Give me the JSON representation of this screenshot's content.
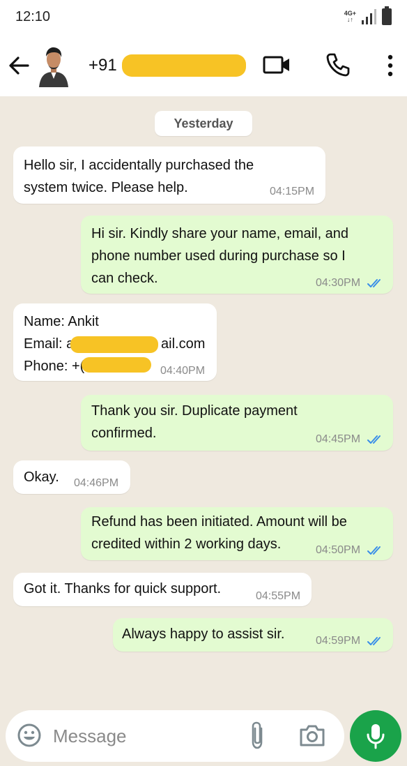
{
  "status_bar": {
    "time": "12:10",
    "network": "4G+",
    "network_arrows": "↓↑"
  },
  "header": {
    "contact_number": "+91",
    "icons": [
      "back-arrow-icon",
      "video-call-icon",
      "voice-call-icon",
      "more-vert-icon"
    ]
  },
  "chat": {
    "date_label": "Yesterday",
    "messages": [
      {
        "direction": "in",
        "text": "Hello sir, I accidentally purchased the\nsystem twice. Please help.",
        "time": "04:15PM"
      },
      {
        "direction": "out",
        "text": "Hi sir. Kindly share your name, email, and\nphone number used during purchase so I\ncan check.",
        "time": "04:30PM",
        "status": "read"
      },
      {
        "direction": "in",
        "name_line": "Name: Ankit",
        "email_prefix": "Email: a",
        "email_suffix": "ail.com",
        "phone_prefix": "Phone: +(",
        "time": "04:40PM"
      },
      {
        "direction": "out",
        "text": "Thank you sir. Duplicate payment\nconfirmed.",
        "time": "04:45PM",
        "status": "read"
      },
      {
        "direction": "in",
        "text": "Okay.",
        "time": "04:46PM"
      },
      {
        "direction": "out",
        "text": "Refund has been initiated. Amount will be\ncredited within 2 working days.",
        "time": "04:50PM",
        "status": "read"
      },
      {
        "direction": "in",
        "text": "Got it. Thanks for quick support.",
        "time": "04:55PM"
      },
      {
        "direction": "out",
        "text": "Always happy to assist sir.",
        "time": "04:59PM",
        "status": "read"
      }
    ]
  },
  "composer": {
    "placeholder": "Message",
    "icons": [
      "emoji-icon",
      "attach-icon",
      "camera-icon",
      "mic-icon"
    ]
  },
  "colors": {
    "accent_green": "#1aa34a",
    "outgoing_bubble": "#e3fbd1",
    "incoming_bubble": "#ffffff",
    "chat_background": "#efe9df",
    "read_tick": "#3a8ee8",
    "redaction": "#f7c325"
  }
}
